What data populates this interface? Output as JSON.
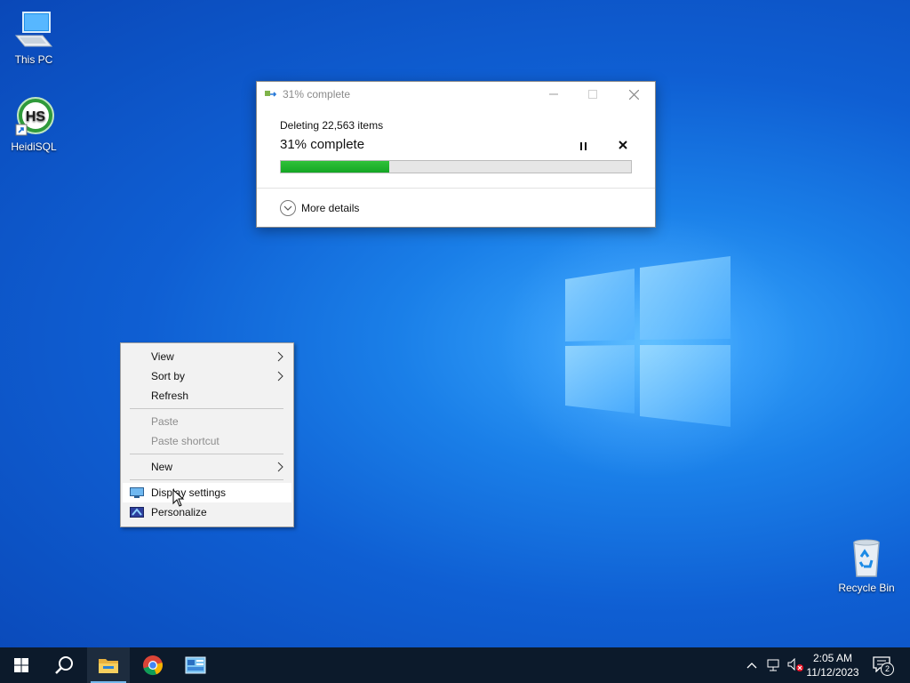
{
  "desktop": {
    "icons": [
      {
        "label": "This PC"
      },
      {
        "label": "HeidiSQL"
      },
      {
        "label": "Recycle Bin"
      }
    ],
    "heidisql_logo_text": "HS"
  },
  "progress_dialog": {
    "title": "31% complete",
    "deleting_text": "Deleting 22,563 items",
    "percent_text": "31% complete",
    "progress_percent": 31,
    "more_details_label": "More details"
  },
  "context_menu": {
    "items": [
      {
        "label": "View",
        "enabled": true,
        "submenu": true
      },
      {
        "label": "Sort by",
        "enabled": true,
        "submenu": true
      },
      {
        "label": "Refresh",
        "enabled": true,
        "submenu": false
      },
      {
        "label": "Paste",
        "enabled": false,
        "submenu": false
      },
      {
        "label": "Paste shortcut",
        "enabled": false,
        "submenu": false
      },
      {
        "label": "New",
        "enabled": true,
        "submenu": true
      },
      {
        "label": "Display settings",
        "enabled": true,
        "submenu": false
      },
      {
        "label": "Personalize",
        "enabled": true,
        "submenu": false
      }
    ]
  },
  "taskbar": {
    "clock_time": "2:05 AM",
    "clock_date": "11/12/2023",
    "notification_count": "2",
    "pinned": [
      "start-icon",
      "search-icon",
      "file-explorer-icon",
      "chrome-icon",
      "control-panel-icon"
    ]
  },
  "colors": {
    "progress_green": "#14a624",
    "taskbar": "#0c1a2b",
    "desktop_blue": "#0f5fd3"
  }
}
